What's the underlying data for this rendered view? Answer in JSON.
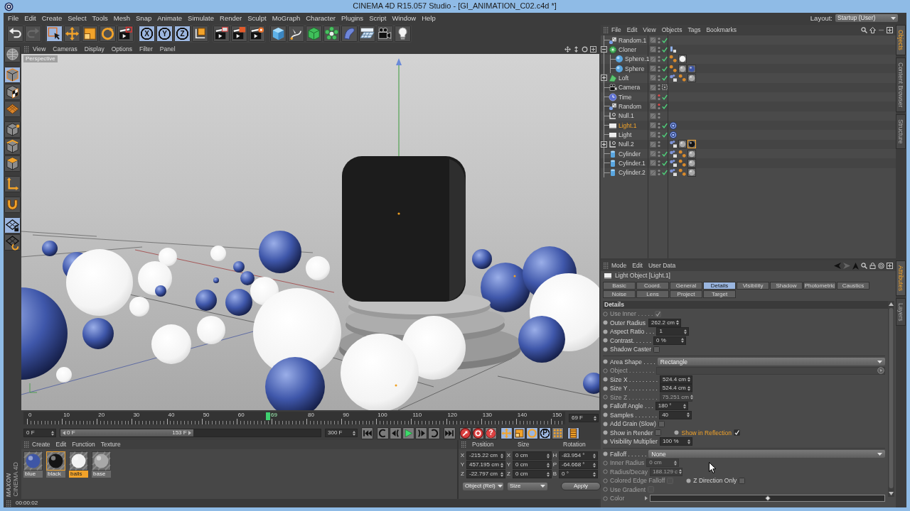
{
  "window": {
    "title": "CINEMA 4D R15.057 Studio - [GI_ANIMATION_C02.c4d *]"
  },
  "menu_bar": {
    "items": [
      "File",
      "Edit",
      "Create",
      "Select",
      "Tools",
      "Mesh",
      "Snap",
      "Animate",
      "Simulate",
      "Render",
      "Sculpt",
      "MoGraph",
      "Character",
      "Plugins",
      "Script",
      "Window",
      "Help"
    ],
    "layout_label": "Layout:",
    "layout_value": "Startup (User)"
  },
  "toolbar": [
    [
      {
        "kind": "undo",
        "active": false,
        "disabled": false
      },
      {
        "kind": "redo",
        "active": false,
        "disabled": true
      }
    ],
    [
      {
        "kind": "live-select",
        "active": true,
        "disabled": false
      },
      {
        "kind": "move",
        "active": false,
        "disabled": false
      },
      {
        "kind": "scale",
        "active": false,
        "disabled": false
      },
      {
        "kind": "rotate",
        "active": false,
        "disabled": false
      },
      {
        "kind": "recent-tools",
        "active": false,
        "disabled": false
      }
    ],
    [
      {
        "kind": "axis",
        "label": "X",
        "active": true,
        "disabled": false
      },
      {
        "kind": "axis",
        "label": "Y",
        "active": true,
        "disabled": false
      },
      {
        "kind": "axis",
        "label": "Z",
        "active": true,
        "disabled": false
      },
      {
        "kind": "coordinate-system",
        "active": false,
        "disabled": false
      }
    ],
    [
      {
        "kind": "render-view",
        "active": false,
        "disabled": false
      },
      {
        "kind": "render-picture-viewer",
        "active": false,
        "disabled": false
      },
      {
        "kind": "render-settings",
        "active": false,
        "disabled": false
      }
    ],
    [
      {
        "kind": "cube",
        "active": false,
        "disabled": false
      },
      {
        "kind": "pen",
        "active": false,
        "disabled": false
      },
      {
        "kind": "subdivision",
        "active": false,
        "disabled": false
      },
      {
        "kind": "array",
        "active": false,
        "disabled": false
      },
      {
        "kind": "deformer",
        "active": false,
        "disabled": false
      },
      {
        "kind": "floor",
        "active": false,
        "disabled": false
      },
      {
        "kind": "camera",
        "active": false,
        "disabled": false
      },
      {
        "kind": "light",
        "active": false,
        "disabled": false
      }
    ]
  ],
  "left_tools": [
    [
      {
        "kind": "make-editable",
        "active": false
      }
    ],
    [
      {
        "kind": "model",
        "active": true
      },
      {
        "kind": "texture",
        "active": false
      },
      {
        "kind": "workplane",
        "active": false
      }
    ],
    [
      {
        "kind": "points",
        "active": false
      },
      {
        "kind": "edges",
        "active": false
      },
      {
        "kind": "polygons",
        "active": false
      }
    ],
    [
      {
        "kind": "axis",
        "active": false
      }
    ],
    [
      {
        "kind": "snap",
        "active": false
      }
    ],
    [
      {
        "kind": "lock-workplane",
        "active": true
      },
      {
        "kind": "align-workplane",
        "active": false
      }
    ]
  ],
  "viewport": {
    "menu": [
      "View",
      "Cameras",
      "Display",
      "Options",
      "Filter",
      "Panel"
    ],
    "camera_label": "Perspective"
  },
  "timeline": {
    "ticks": [
      "0",
      "10",
      "20",
      "30",
      "40",
      "50",
      "60",
      "80",
      "90",
      "100",
      "110",
      "120",
      "130",
      "140",
      "150"
    ],
    "current": "69",
    "frame_field": "69 F"
  },
  "range": {
    "start_field": "0 F",
    "range_start": "0 F",
    "range_end": "153 F",
    "level": 0.51,
    "end_field": "300 F"
  },
  "transport": [
    [
      {
        "kind": "go-start",
        "active": false
      }
    ],
    [
      {
        "kind": "loop-back",
        "active": false
      },
      {
        "kind": "prev-frame",
        "active": false
      },
      {
        "kind": "play",
        "active": false
      },
      {
        "kind": "next-frame",
        "active": false
      },
      {
        "kind": "loop-forward",
        "active": false
      }
    ],
    [
      {
        "kind": "go-end",
        "active": false
      }
    ],
    [
      {
        "kind": "record",
        "active": false
      },
      {
        "kind": "auto-key",
        "active": false
      },
      {
        "kind": "key-selection",
        "label": "?",
        "active": false
      }
    ],
    [
      {
        "kind": "key-position",
        "active": true
      },
      {
        "kind": "key-scale",
        "active": true
      },
      {
        "kind": "key-rotation",
        "active": true
      },
      {
        "kind": "key-parameter",
        "label": "P",
        "active": true
      },
      {
        "kind": "key-point-level",
        "active": false
      }
    ],
    [
      {
        "kind": "timeline",
        "active": true
      }
    ]
  ],
  "logo": {
    "company": "MAXON",
    "product": "CINEMA 4D"
  },
  "materials": {
    "menu": [
      "Create",
      "Edit",
      "Function",
      "Texture"
    ],
    "items": [
      {
        "name": "blue",
        "color": "#3e56a6",
        "selected": false,
        "highlighted": false
      },
      {
        "name": "black",
        "color": "#141414",
        "selected": false,
        "highlighted": true
      },
      {
        "name": "balls",
        "color": "#f2f2f2",
        "selected": true,
        "highlighted": false
      },
      {
        "name": "base",
        "color": "#a8a8a8",
        "selected": false,
        "highlighted": false
      }
    ]
  },
  "coordinates": {
    "headers": [
      "Position",
      "Size",
      "Rotation"
    ],
    "rows": [
      [
        {
          "axis": "X",
          "value": "-215.22 cm"
        },
        {
          "axis": "X",
          "value": "0 cm"
        },
        {
          "axis": "H",
          "value": "-83.954 °"
        }
      ],
      [
        {
          "axis": "Y",
          "value": "457.195 cm"
        },
        {
          "axis": "Y",
          "value": "0 cm"
        },
        {
          "axis": "P",
          "value": "-64.668 °"
        }
      ],
      [
        {
          "axis": "Z",
          "value": "-22.797 cm"
        },
        {
          "axis": "Z",
          "value": "0 cm"
        },
        {
          "axis": "B",
          "value": "0 °"
        }
      ]
    ],
    "mode": "Object (Rel)",
    "size_mode": "Size",
    "apply": "Apply"
  },
  "status_bar": {
    "text": "00:00:02"
  },
  "object_manager": {
    "menu": [
      "File",
      "Edit",
      "View",
      "Objects",
      "Tags",
      "Bookmarks"
    ],
    "objects": [
      {
        "name": "Random.1",
        "kind": "random",
        "selected": false,
        "editor_off": false,
        "enabled": true
      },
      {
        "name": "Cloner",
        "kind": "cloner",
        "selected": false,
        "editor_off": false,
        "enabled": true,
        "expanded": true,
        "tags": [
          {
            "kind": "display",
            "selected": false
          }
        ],
        "children": [
          {
            "name": "Sphere.1",
            "kind": "sphere",
            "selected": false,
            "editor_off": false,
            "enabled": true,
            "tags": [
              {
                "kind": "phong",
                "selected": false
              },
              {
                "kind": "material",
                "color": "#f2f2f2",
                "selected": false
              }
            ]
          },
          {
            "name": "Sphere",
            "kind": "sphere",
            "selected": false,
            "editor_off": false,
            "enabled": true,
            "tags": [
              {
                "kind": "phong",
                "selected": false
              },
              {
                "kind": "material",
                "color": "#a8a8a8",
                "selected": false
              },
              {
                "kind": "material",
                "color": "#3e56a6",
                "selected": false
              }
            ]
          }
        ]
      },
      {
        "name": "Loft",
        "kind": "loft",
        "selected": false,
        "editor_off": false,
        "enabled": true,
        "expanded": false,
        "tags": [
          {
            "kind": "compositing",
            "selected": false
          },
          {
            "kind": "phong",
            "selected": false
          },
          {
            "kind": "material",
            "color": "#a8a8a8",
            "selected": false
          }
        ]
      },
      {
        "name": "Camera",
        "kind": "camera",
        "selected": false,
        "editor_off": false,
        "enabled": false
      },
      {
        "name": "Time",
        "kind": "time",
        "selected": false,
        "editor_off": true,
        "enabled": true
      },
      {
        "name": "Random",
        "kind": "random",
        "selected": false,
        "editor_off": true,
        "enabled": true
      },
      {
        "name": "Null.1",
        "kind": "null",
        "selected": false,
        "editor_off": false,
        "enabled": false
      },
      {
        "name": "Light.1",
        "kind": "light",
        "selected": true,
        "editor_off": false,
        "enabled": true,
        "tags": [
          {
            "kind": "target",
            "selected": false
          }
        ]
      },
      {
        "name": "Light",
        "kind": "light",
        "selected": false,
        "editor_off": false,
        "enabled": true,
        "tags": [
          {
            "kind": "target",
            "selected": false
          }
        ]
      },
      {
        "name": "Null.2",
        "kind": "null",
        "selected": false,
        "editor_off": false,
        "enabled": false,
        "expanded": false,
        "tags": [
          {
            "kind": "compositing",
            "selected": false
          },
          {
            "kind": "material",
            "color": "#a8a8a8",
            "selected": false
          },
          {
            "kind": "material",
            "color": "#141414",
            "selected": true
          }
        ]
      },
      {
        "name": "Cylinder",
        "kind": "cylinder",
        "selected": false,
        "editor_off": false,
        "enabled": true,
        "tags": [
          {
            "kind": "compositing",
            "selected": false
          },
          {
            "kind": "phong",
            "selected": false
          },
          {
            "kind": "material",
            "color": "#a8a8a8",
            "selected": false
          }
        ]
      },
      {
        "name": "Cylinder.1",
        "kind": "cylinder",
        "selected": false,
        "editor_off": false,
        "enabled": true,
        "tags": [
          {
            "kind": "compositing",
            "selected": false
          },
          {
            "kind": "phong",
            "selected": false
          },
          {
            "kind": "material",
            "color": "#a8a8a8",
            "selected": false
          }
        ]
      },
      {
        "name": "Cylinder.2",
        "kind": "cylinder",
        "selected": false,
        "editor_off": false,
        "enabled": true,
        "tags": [
          {
            "kind": "compositing",
            "selected": false
          },
          {
            "kind": "phong",
            "selected": false
          },
          {
            "kind": "material",
            "color": "#a8a8a8",
            "selected": false
          }
        ]
      }
    ]
  },
  "object_side_tabs": [
    {
      "label": "Objects",
      "selected": true
    },
    {
      "label": "Content Browser",
      "selected": false
    },
    {
      "label": "Structure",
      "selected": false
    }
  ],
  "attributes": {
    "menu": [
      "Mode",
      "Edit",
      "User Data"
    ],
    "object_title": "Light Object [Light.1]",
    "tabs": [
      [
        {
          "label": "Basic",
          "selected": false
        },
        {
          "label": "Coord.",
          "selected": false
        },
        {
          "label": "General",
          "selected": false
        },
        {
          "label": "Details",
          "selected": true
        },
        {
          "label": "Visibility",
          "selected": false
        },
        {
          "label": "Shadow",
          "selected": false
        },
        {
          "label": "Photometric",
          "selected": false
        },
        {
          "label": "Caustics",
          "selected": false
        }
      ],
      [
        {
          "label": "Noise",
          "selected": false
        },
        {
          "label": "Lens",
          "selected": false
        },
        {
          "label": "Project",
          "selected": false
        },
        {
          "label": "Target",
          "selected": false
        }
      ]
    ],
    "section": "Details",
    "groups": [
      [
        {
          "kind": "checkbox",
          "label": "Use Inner . . . . .",
          "checked": true,
          "disabled": true,
          "highlighted": false
        },
        {
          "kind": "number",
          "label": "Outer Radius",
          "value": "262.2 cm",
          "disabled": false,
          "highlighted": false
        },
        {
          "kind": "number",
          "label": "Aspect Ratio . . .",
          "value": "1",
          "disabled": false,
          "highlighted": false
        },
        {
          "kind": "number",
          "label": "Contrast. . . . . .",
          "value": "0 %",
          "disabled": false,
          "highlighted": false
        },
        {
          "kind": "checkbox",
          "label": "Shadow Caster",
          "checked": false,
          "disabled": false,
          "highlighted": false
        }
      ],
      [
        {
          "kind": "dropdown",
          "label": "Area Shape . . . .",
          "value": "Rectangle",
          "disabled": false,
          "highlighted": false
        },
        {
          "kind": "link",
          "label": "Object . . . . . . . .",
          "disabled": true,
          "highlighted": false
        },
        {
          "kind": "number",
          "label": "Size X . . . . . . . . .",
          "value": "524.4 cm",
          "disabled": false,
          "highlighted": false
        },
        {
          "kind": "number",
          "label": "Size Y . . . . . . . . .",
          "value": "524.4 cm",
          "disabled": false,
          "highlighted": false
        },
        {
          "kind": "number",
          "label": "Size Z . . . . . . . . .",
          "value": "75.251 cm",
          "disabled": true,
          "highlighted": false
        },
        {
          "kind": "number",
          "label": "Falloff Angle . . .",
          "value": "180 °",
          "disabled": false,
          "highlighted": false
        },
        {
          "kind": "number",
          "label": "Samples . . . . . . .",
          "value": "40",
          "disabled": false,
          "highlighted": false
        },
        {
          "kind": "checkbox",
          "label": "Add Grain (Slow)",
          "checked": false,
          "disabled": false,
          "highlighted": false
        },
        {
          "kind": "pair",
          "items": [
            {
              "kind": "checkbox",
              "label": "Show in Render",
              "checked": false,
              "disabled": false,
              "highlighted": false
            },
            {
              "kind": "checkbox",
              "label": "Show in Reflection",
              "checked": true,
              "disabled": false,
              "highlighted": true
            }
          ]
        },
        {
          "kind": "number",
          "label": "Visibility Multiplier",
          "value": "100 %",
          "disabled": false,
          "highlighted": false
        }
      ],
      [
        {
          "kind": "dropdown",
          "label": "Falloff . . . . . .",
          "value": "None",
          "disabled": false,
          "highlighted": false
        },
        {
          "kind": "number",
          "label": "Inner Radius",
          "value": "0 cm",
          "disabled": true,
          "highlighted": false
        },
        {
          "kind": "number",
          "label": "Radius/Decay",
          "value": "188.129 c",
          "disabled": true,
          "highlighted": false
        },
        {
          "kind": "pair",
          "items": [
            {
              "kind": "checkbox",
              "label": "Colored Edge Falloff",
              "checked": false,
              "disabled": true,
              "highlighted": false
            },
            {
              "kind": "checkbox",
              "label": "Z Direction Only",
              "checked": false,
              "disabled": false,
              "highlighted": false
            }
          ]
        },
        {
          "kind": "checkbox",
          "label": "Use Gradient",
          "checked": false,
          "disabled": true,
          "highlighted": false
        },
        {
          "kind": "gradient",
          "label": "Color",
          "disabled": true,
          "highlighted": false
        }
      ]
    ]
  },
  "attribute_side_tabs": [
    {
      "label": "Attributes",
      "selected": true
    },
    {
      "label": "Layers",
      "selected": false
    }
  ]
}
